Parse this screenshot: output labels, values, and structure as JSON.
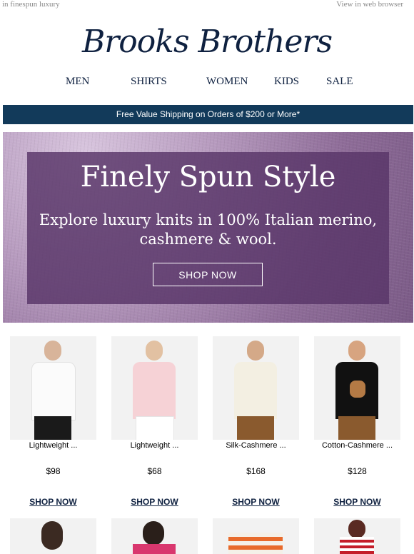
{
  "preheader": {
    "left_text": "in finespun luxury",
    "right_link": "View in web browser"
  },
  "brand": {
    "logo_text": "Brooks Brothers"
  },
  "nav": {
    "items": [
      "MEN",
      "SHIRTS",
      "WOMEN",
      "KIDS",
      "SALE"
    ]
  },
  "shipping_banner": {
    "text": "Free Value Shipping on Orders of $200 or More*"
  },
  "hero": {
    "title": "Finely Spun Style",
    "subtitle_line1": "Explore luxury knits in 100% Italian merino,",
    "subtitle_line2": "cashmere & wool.",
    "cta": "SHOP NOW"
  },
  "products": [
    {
      "name": "Lightweight ...",
      "price": "$98",
      "cta": "SHOP NOW"
    },
    {
      "name": "Lightweight ...",
      "price": "$68",
      "cta": "SHOP NOW"
    },
    {
      "name": "Silk-Cashmere ...",
      "price": "$168",
      "cta": "SHOP NOW"
    },
    {
      "name": "Cotton-Cashmere ...",
      "price": "$128",
      "cta": "SHOP NOW"
    }
  ],
  "colors": {
    "navy": "#0f2140",
    "banner": "#123a5a",
    "hero_purple": "#583468"
  }
}
